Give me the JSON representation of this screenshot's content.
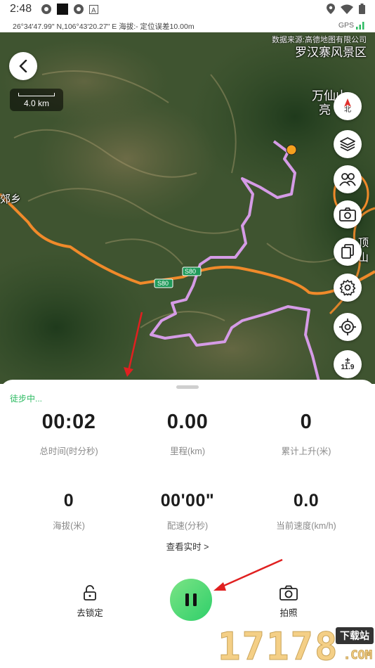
{
  "status_bar": {
    "time": "2:48",
    "gps_label": "GPS",
    "coordinates": "26°34'47.99\" N,106°43'20.27\" E 海拔:- 定位误差10.00m"
  },
  "map": {
    "source": "数据来源:高德地图有限公司",
    "labels": {
      "scenic_area": "罗汉寨风景区",
      "wanxian": "万仙山",
      "liang": "亮",
      "jiao_xiang": "郊乡",
      "ding_shan": "顶山",
      "road_s80_a": "S80",
      "road_s80_b": "S80"
    },
    "scale_label": "4.0 km",
    "compass_label": "北",
    "zoom_label": "11.9",
    "colors": {
      "track": "#d59be6",
      "road": "#f08a2a",
      "marker": "#f5a01e"
    }
  },
  "panel": {
    "state": "徒步中...",
    "stats": [
      {
        "value": "00:02",
        "label": "总时间(时分秒)"
      },
      {
        "value": "0.00",
        "label": "里程(km)"
      },
      {
        "value": "0",
        "label": "累计上升(米)"
      },
      {
        "value": "0",
        "label": "海拔(米)"
      },
      {
        "value": "00'00\"",
        "label": "配速(分秒)"
      },
      {
        "value": "0.0",
        "label": "当前速度(km/h)"
      }
    ],
    "realtime_link": "查看实时 >",
    "lock_label": "去锁定",
    "photo_label": "拍照",
    "accent": "#2dbb62"
  },
  "watermark": {
    "main": "17178",
    "badge": "下载站",
    "domain": ".COM"
  }
}
